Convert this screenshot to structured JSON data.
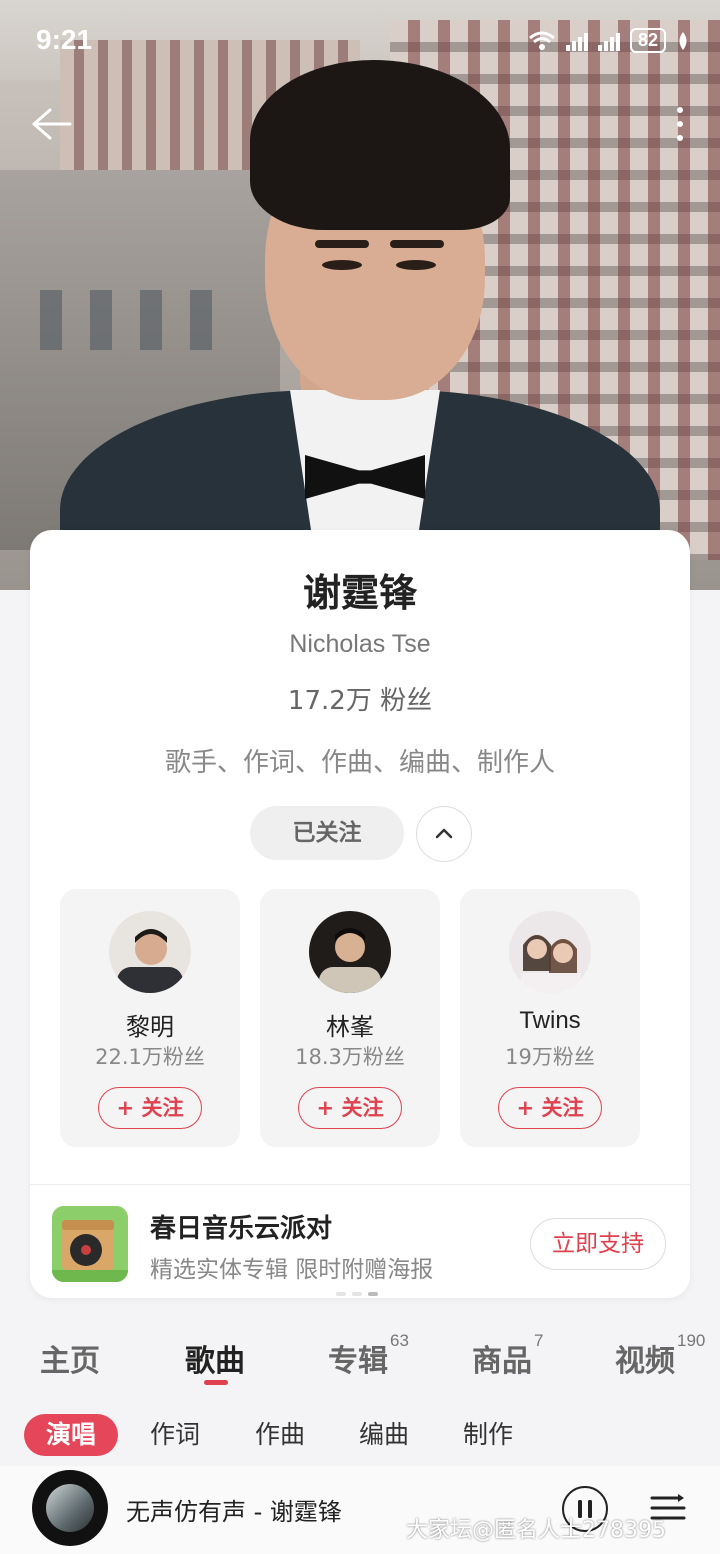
{
  "status_bar": {
    "time": "9:21",
    "battery": "82"
  },
  "artist": {
    "name": "谢霆锋",
    "english_name": "Nicholas Tse",
    "fans": "17.2万 粉丝",
    "roles": "歌手、作词、作曲、编曲、制作人",
    "follow_state": "已关注"
  },
  "recommended": [
    {
      "name": "黎明",
      "fans": "22.1万粉丝",
      "follow_label": "+ 关注"
    },
    {
      "name": "林峯",
      "fans": "18.3万粉丝",
      "follow_label": "+ 关注"
    },
    {
      "name": "Twins",
      "fans": "19万粉丝",
      "follow_label": "+ 关注"
    }
  ],
  "promo": {
    "title": "春日音乐云派对",
    "subtitle": "精选实体专辑 限时附赠海报",
    "button": "立即支持"
  },
  "tabs": [
    {
      "label": "主页",
      "count": ""
    },
    {
      "label": "歌曲",
      "count": ""
    },
    {
      "label": "专辑",
      "count": "63"
    },
    {
      "label": "商品",
      "count": "7"
    },
    {
      "label": "视频",
      "count": "190"
    }
  ],
  "subtabs": [
    "演唱",
    "作词",
    "作曲",
    "编曲",
    "制作"
  ],
  "player": {
    "song": "无声仿有声 - 谢霆锋"
  },
  "watermark": "大家坛@匿名人士278395",
  "colors": {
    "accent": "#e0414f",
    "card": "#ffffff",
    "background": "#f4f4f6"
  }
}
